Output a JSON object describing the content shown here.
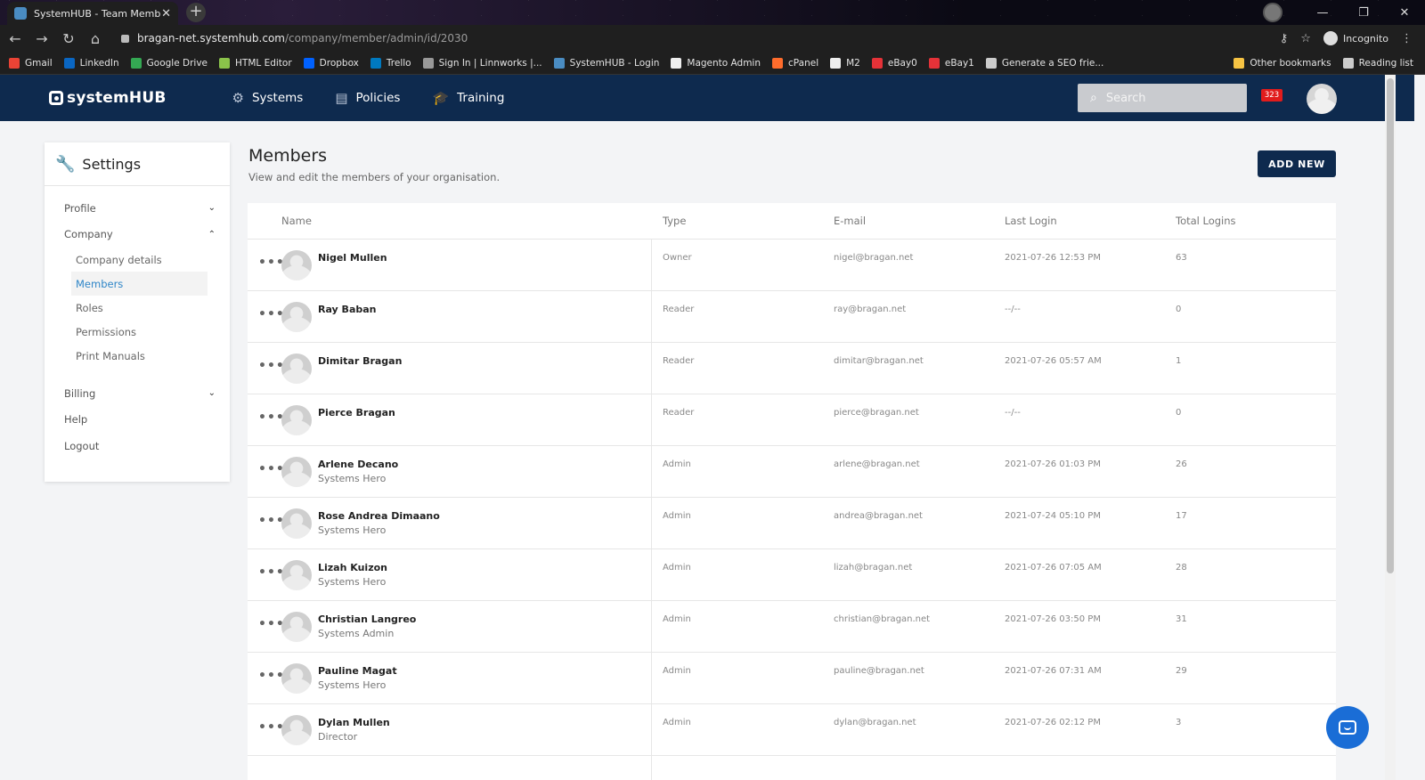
{
  "browser": {
    "tab_title": "SystemHUB - Team Members",
    "tab_close": "✕",
    "new_tab": "+",
    "url_host": "bragan-net.systemhub.com",
    "url_path": "/company/member/admin/id/2030",
    "incognito_label": "Incognito",
    "win_min": "—",
    "win_restore": "❐",
    "win_close": "✕",
    "bookmarks": [
      {
        "label": "Gmail",
        "color": "#ea4335"
      },
      {
        "label": "LinkedIn",
        "color": "#0a66c2"
      },
      {
        "label": "Google Drive",
        "color": "#34a853"
      },
      {
        "label": "HTML Editor",
        "color": "#8bc34a"
      },
      {
        "label": "Dropbox",
        "color": "#0061ff"
      },
      {
        "label": "Trello",
        "color": "#0079bf"
      },
      {
        "label": "Sign In | Linnworks |...",
        "color": "#999999"
      },
      {
        "label": "SystemHUB - Login",
        "color": "#4a8cc2"
      },
      {
        "label": "Magento Admin",
        "color": "#eeeeee"
      },
      {
        "label": "cPanel",
        "color": "#ff6c2c"
      },
      {
        "label": "M2",
        "color": "#eeeeee"
      },
      {
        "label": "eBay0",
        "color": "#e53238"
      },
      {
        "label": "eBay1",
        "color": "#e53238"
      },
      {
        "label": "Generate a SEO frie...",
        "color": "#cccccc"
      }
    ],
    "bookmarks_right": [
      {
        "label": "Other bookmarks",
        "color": "#f6c343"
      },
      {
        "label": "Reading list",
        "color": "#cccccc"
      }
    ]
  },
  "header": {
    "logo": "systemHUB",
    "nav": [
      {
        "label": "Systems",
        "icon": "gear-icon",
        "glyph": "⚙"
      },
      {
        "label": "Policies",
        "icon": "document-icon",
        "glyph": "▤"
      },
      {
        "label": "Training",
        "icon": "graduation-cap-icon",
        "glyph": "🎓"
      }
    ],
    "search_placeholder": "Search",
    "notification_count": "323"
  },
  "sidebar": {
    "title": "Settings",
    "items": {
      "profile": "Profile",
      "company": "Company",
      "company_details": "Company details",
      "members": "Members",
      "roles": "Roles",
      "permissions": "Permissions",
      "print_manuals": "Print Manuals",
      "billing": "Billing",
      "help": "Help",
      "logout": "Logout"
    }
  },
  "main": {
    "title": "Members",
    "subtitle": "View and edit the members of your organisation.",
    "add_new": "ADD NEW",
    "columns": {
      "name": "Name",
      "type": "Type",
      "email": "E-mail",
      "last_login": "Last Login",
      "total_logins": "Total Logins"
    },
    "members": [
      {
        "name": "Nigel Mullen",
        "role": "",
        "type": "Owner",
        "email": "nigel@bragan.net",
        "last_login": "2021-07-26 12:53 PM",
        "total": "63"
      },
      {
        "name": "Ray Baban",
        "role": "",
        "type": "Reader",
        "email": "ray@bragan.net",
        "last_login": "--/--",
        "total": "0"
      },
      {
        "name": "Dimitar Bragan",
        "role": "",
        "type": "Reader",
        "email": "dimitar@bragan.net",
        "last_login": "2021-07-26 05:57 AM",
        "total": "1"
      },
      {
        "name": "Pierce Bragan",
        "role": "",
        "type": "Reader",
        "email": "pierce@bragan.net",
        "last_login": "--/--",
        "total": "0"
      },
      {
        "name": "Arlene Decano",
        "role": "Systems Hero",
        "type": "Admin",
        "email": "arlene@bragan.net",
        "last_login": "2021-07-26 01:03 PM",
        "total": "26"
      },
      {
        "name": "Rose Andrea Dimaano",
        "role": "Systems Hero",
        "type": "Admin",
        "email": "andrea@bragan.net",
        "last_login": "2021-07-24 05:10 PM",
        "total": "17"
      },
      {
        "name": "Lizah Kuizon",
        "role": "Systems Hero",
        "type": "Admin",
        "email": "lizah@bragan.net",
        "last_login": "2021-07-26 07:05 AM",
        "total": "28"
      },
      {
        "name": "Christian Langreo",
        "role": "Systems Admin",
        "type": "Admin",
        "email": "christian@bragan.net",
        "last_login": "2021-07-26 03:50 PM",
        "total": "31"
      },
      {
        "name": "Pauline Magat",
        "role": "Systems Hero",
        "type": "Admin",
        "email": "pauline@bragan.net",
        "last_login": "2021-07-26 07:31 AM",
        "total": "29"
      },
      {
        "name": "Dylan Mullen",
        "role": "Director",
        "type": "Admin",
        "email": "dylan@bragan.net",
        "last_login": "2021-07-26 02:12 PM",
        "total": "3"
      }
    ]
  }
}
